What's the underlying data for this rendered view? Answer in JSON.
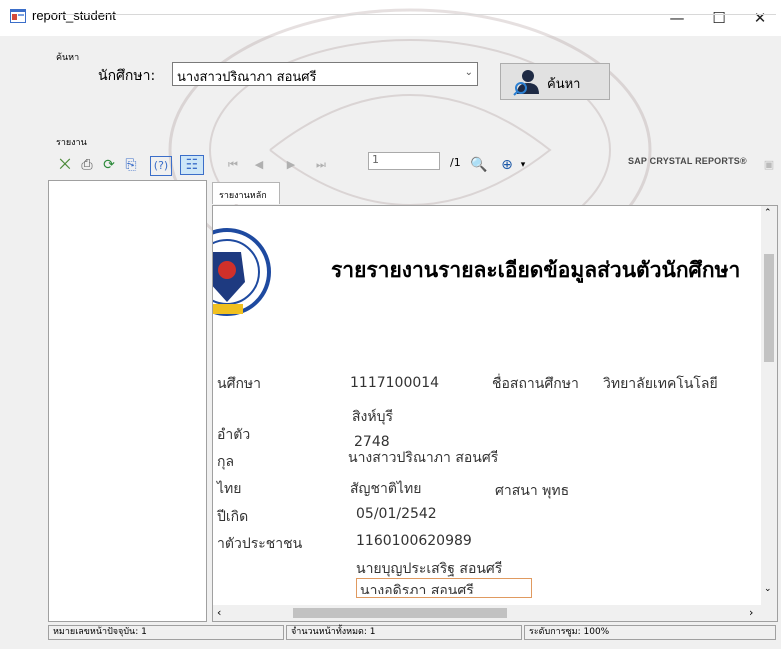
{
  "window": {
    "title": "report_student",
    "minimize": "—",
    "maximize": "☐",
    "close": "✕"
  },
  "search_section": {
    "legend": "ค้นหา",
    "student_label": "นักศึกษา:",
    "student_value": "นางสาวปริณาภา  สอนศรี",
    "search_button": "ค้นหา"
  },
  "report_section": {
    "legend": "รายงาน"
  },
  "toolbar": {
    "page_current": "1",
    "page_total": "/1",
    "brand": "SAP CRYSTAL REPORTS®"
  },
  "report_tab": "รายงานหลัก",
  "report": {
    "title": "รายรายงานรายละเอียดข้อมูลส่วนตัวนักศึกษา",
    "field_school_label_frag": "นศึกษา",
    "school_code": "1117100014",
    "school_name_label": "ชื่อสถานศึกษา",
    "school_name_value": "วิทยาลัยเทคโนโลยี",
    "province": "สิงห์บุรี",
    "id_label_frag": "อำตัว",
    "student_id": "2748",
    "name_label_frag": "กุล",
    "full_name": "นางสาวปริณาภา  สอนศรี",
    "nationality_label_frag": "ไทย",
    "nationality": "สัญชาติไทย",
    "religion": "ศาสนา พุทธ",
    "birth_label_frag": "ปีเกิด",
    "birth_date": "05/01/2542",
    "citizen_label_frag": "าตัวประชาชน",
    "citizen_id": "1160100620989",
    "father_name": "นายบุญประเสริฐ  สอนศรี",
    "mother_name": "นางอดิรภา  สอนศรี"
  },
  "status": {
    "current_page": "หมายเลขหน้าปัจจุบัน: 1",
    "total_pages": "จำนวนหน้าทั้งหมด: 1",
    "zoom": "ระดับการซูม: 100%"
  }
}
